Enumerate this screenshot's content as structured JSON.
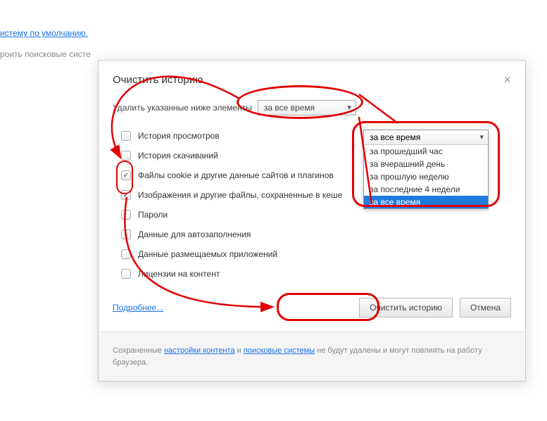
{
  "bg": {
    "link1": "истему по умолчанию.",
    "link2": "роить поисковые систе"
  },
  "dialog": {
    "title": "Очистить историю",
    "prompt": "Удалить указанные ниже элементы",
    "select_value": "за все время",
    "checks": [
      {
        "label": "История просмотров",
        "checked": false
      },
      {
        "label": "История скачиваний",
        "checked": false
      },
      {
        "label": "Файлы cookie и другие данные сайтов и плагинов",
        "checked": true
      },
      {
        "label": "Изображения и другие файлы, сохраненные в кеше",
        "checked": true
      },
      {
        "label": "Пароли",
        "checked": false
      },
      {
        "label": "Данные для автозаполнения",
        "checked": false
      },
      {
        "label": "Данные размещаемых приложений",
        "checked": false
      },
      {
        "label": "Лицензии на контент",
        "checked": false
      }
    ],
    "more_link": "Подробнее...",
    "clear_btn": "Очистить историю",
    "cancel_btn": "Отмена",
    "footer_pre": "Сохраненные ",
    "footer_link1": "настройки контента",
    "footer_mid": " и ",
    "footer_link2": "поисковые системы",
    "footer_post": " не будут удалены и могут повлиять на работу браузера."
  },
  "dropdown": {
    "header": "за все время",
    "options": [
      {
        "label": "за прошедший час",
        "hl": false
      },
      {
        "label": "за вчерашний день",
        "hl": false
      },
      {
        "label": "за прошлую неделю",
        "hl": false
      },
      {
        "label": "за последние 4 недели",
        "hl": false
      },
      {
        "label": "за все время",
        "hl": true
      }
    ]
  }
}
